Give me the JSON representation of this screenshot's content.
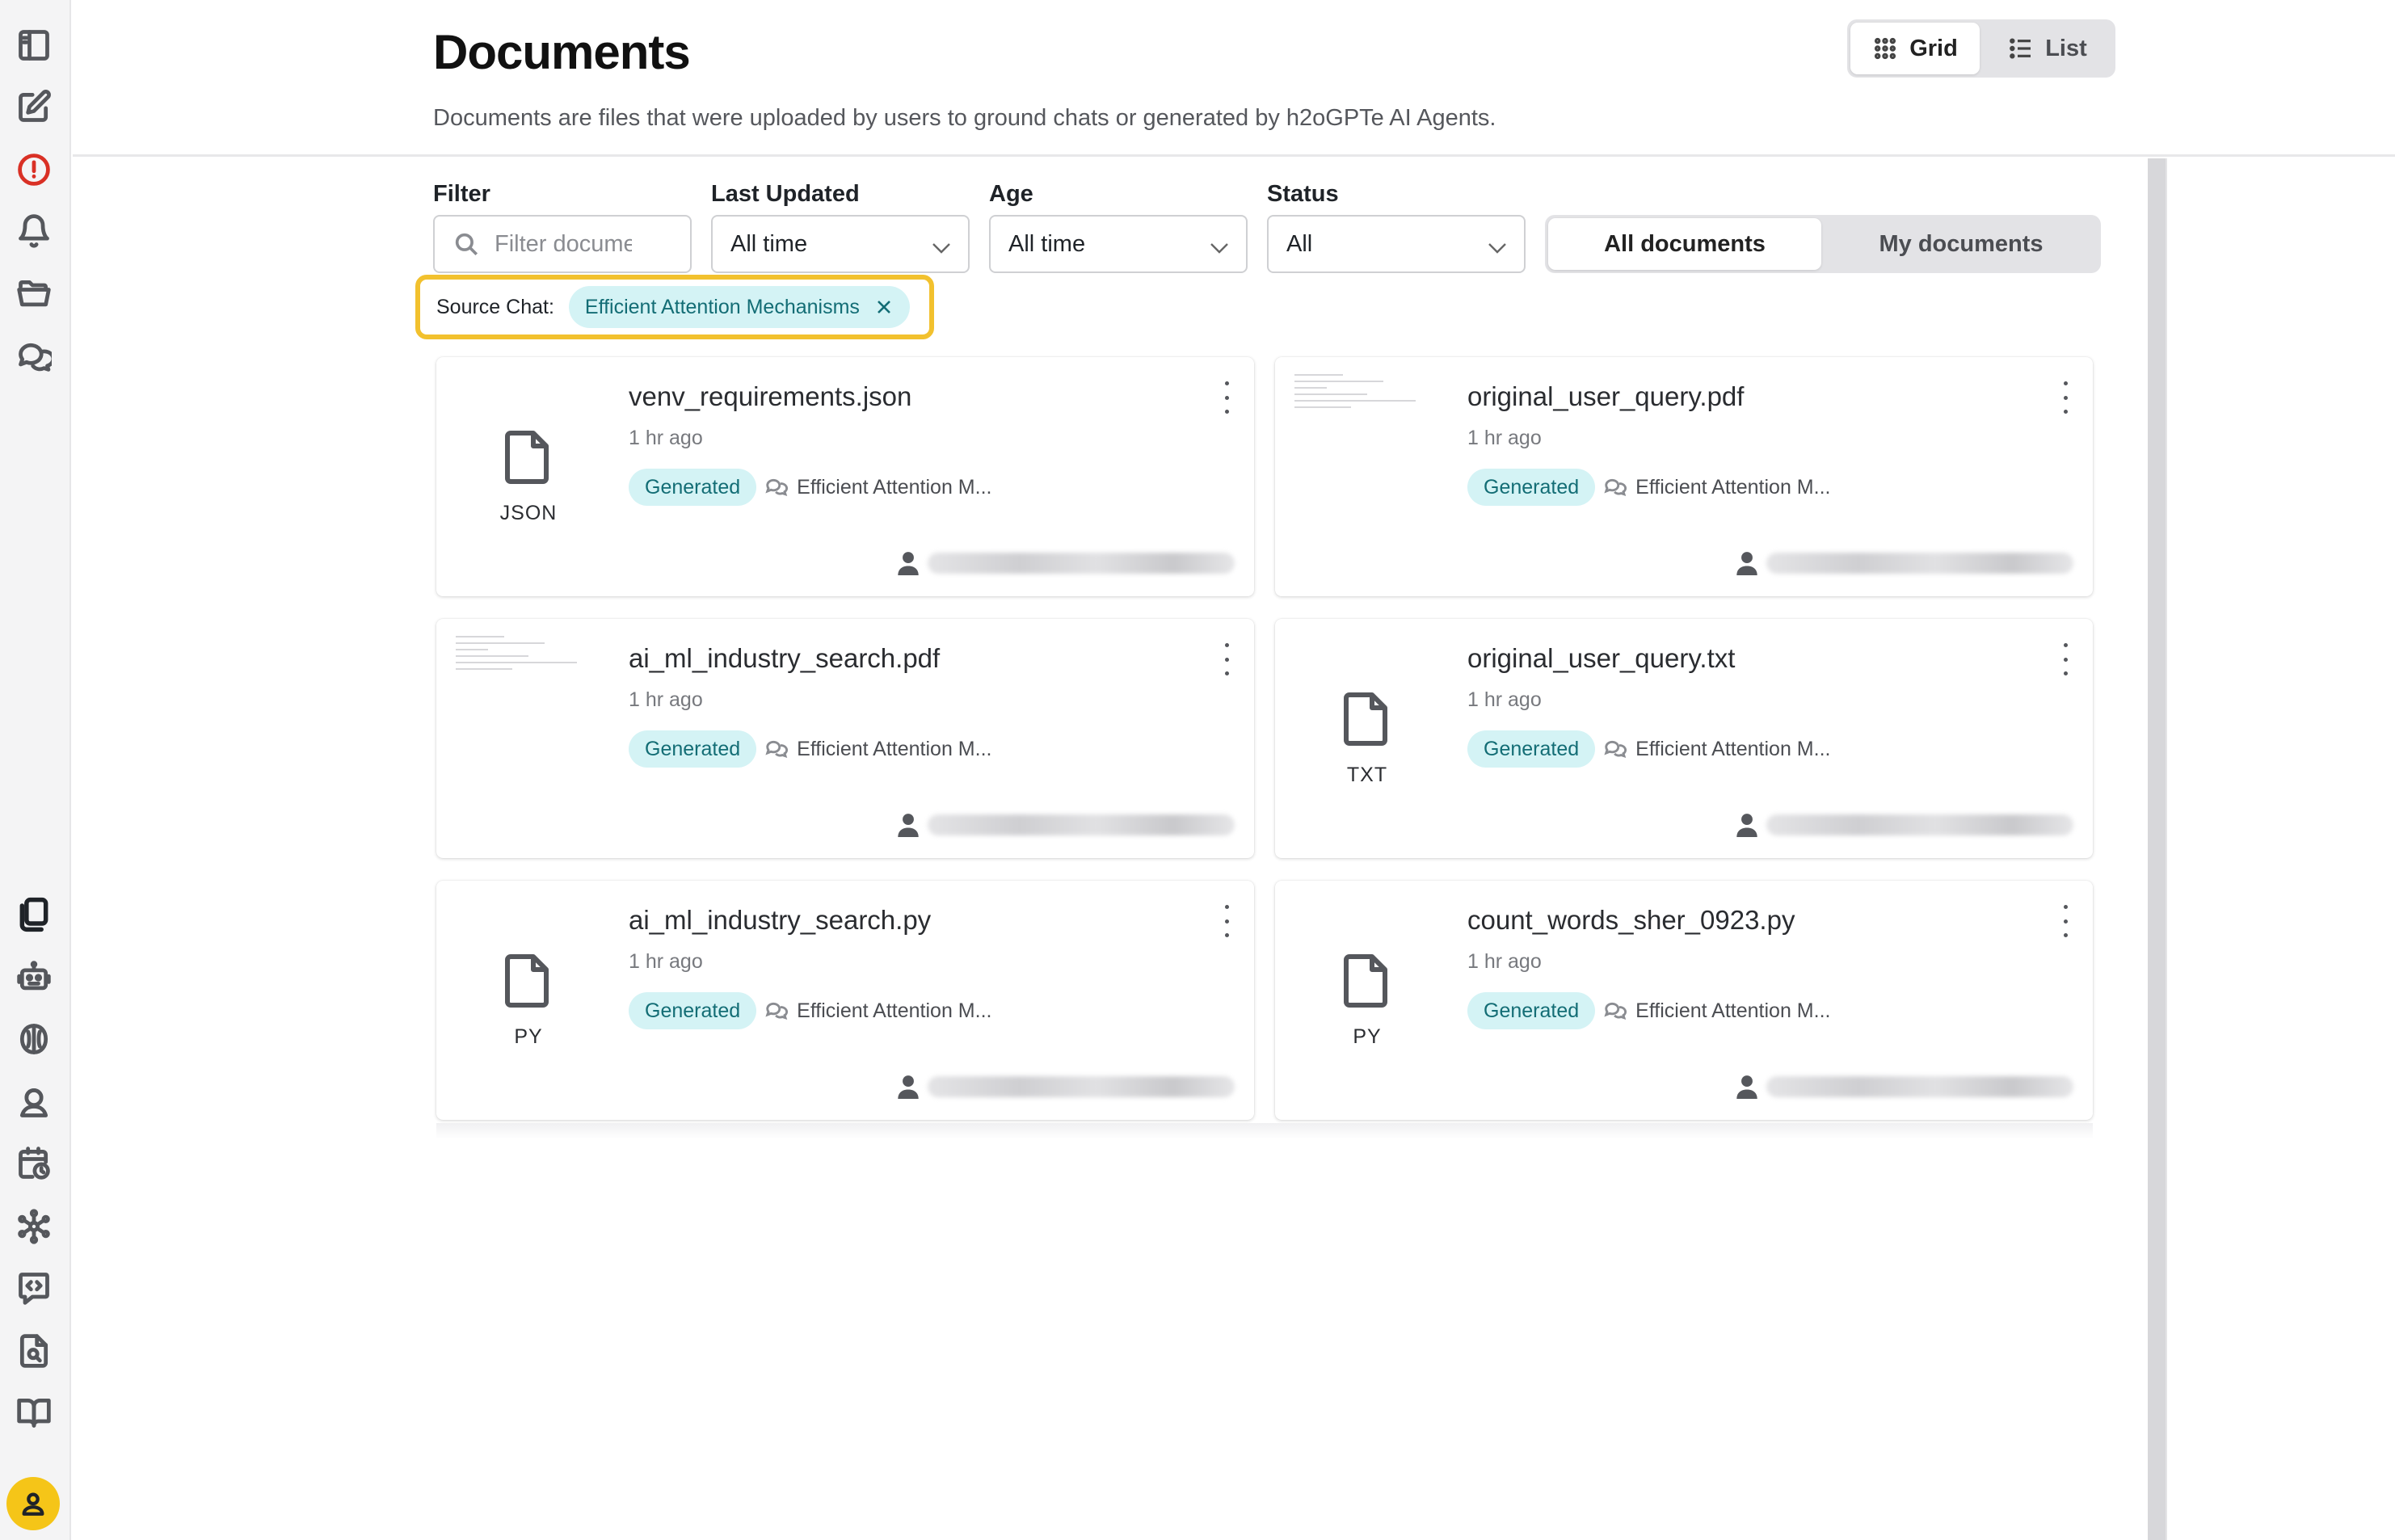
{
  "header": {
    "title": "Documents",
    "description": "Documents are files that were uploaded by users to ground chats or generated by h2oGPTe AI Agents.",
    "view_toggle": {
      "grid_label": "Grid",
      "list_label": "List",
      "selected": "Grid"
    }
  },
  "filters": {
    "filter_label": "Filter",
    "filter_placeholder": "Filter documents",
    "last_updated_label": "Last Updated",
    "last_updated_value": "All time",
    "age_label": "Age",
    "age_value": "All time",
    "status_label": "Status",
    "status_value": "All",
    "scope_all_label": "All documents",
    "scope_mine_label": "My documents",
    "scope_selected": "All documents"
  },
  "source_chat": {
    "label": "Source Chat:",
    "chip_label": "Efficient Attention Mechanisms"
  },
  "documents": [
    {
      "name": "venv_requirements.json",
      "time": "1 hr ago",
      "badge": "Generated",
      "chat": "Efficient Attention M...",
      "thumb": "file-icon",
      "ext": "JSON"
    },
    {
      "name": "original_user_query.pdf",
      "time": "1 hr ago",
      "badge": "Generated",
      "chat": "Efficient Attention M...",
      "thumb": "preview",
      "ext": ""
    },
    {
      "name": "ai_ml_industry_search.pdf",
      "time": "1 hr ago",
      "badge": "Generated",
      "chat": "Efficient Attention M...",
      "thumb": "preview",
      "ext": ""
    },
    {
      "name": "original_user_query.txt",
      "time": "1 hr ago",
      "badge": "Generated",
      "chat": "Efficient Attention M...",
      "thumb": "file-icon",
      "ext": "TXT"
    },
    {
      "name": "ai_ml_industry_search.py",
      "time": "1 hr ago",
      "badge": "Generated",
      "chat": "Efficient Attention M...",
      "thumb": "file-icon",
      "ext": "PY"
    },
    {
      "name": "count_words_sher_0923.py",
      "time": "1 hr ago",
      "badge": "Generated",
      "chat": "Efficient Attention M...",
      "thumb": "file-icon",
      "ext": "PY"
    }
  ],
  "sidebar": {
    "top_icons": [
      "sidebar-toggle-icon",
      "new-chat-icon",
      "alert-icon",
      "notifications-icon",
      "folder-icon",
      "chats-icon"
    ],
    "bottom_icons": [
      "documents-icon",
      "agents-icon",
      "models-icon",
      "support-icon",
      "schedule-icon",
      "network-icon",
      "code-icon",
      "search-document-icon",
      "book-icon"
    ],
    "avatar_icon": "user-icon"
  },
  "colors": {
    "accent_teal_bg": "#d4f3f5",
    "accent_teal_text": "#136d75",
    "highlight_yellow": "#f2c12e",
    "alert_red": "#d93025",
    "avatar_yellow": "#f5c518"
  }
}
